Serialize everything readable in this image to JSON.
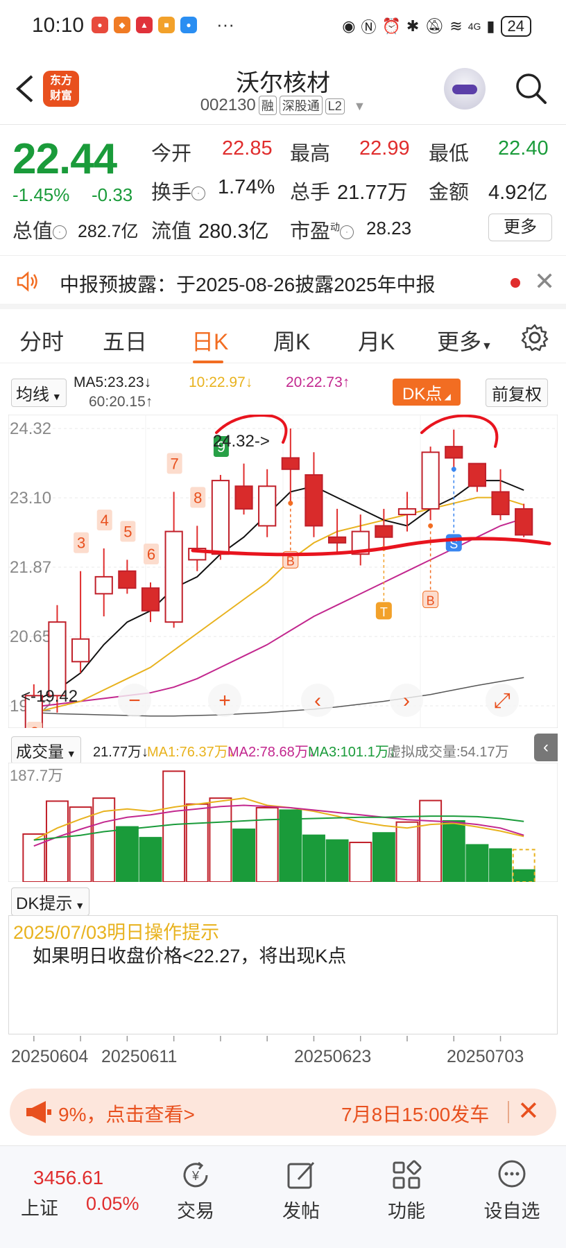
{
  "status": {
    "time": "10:10",
    "battery": "24",
    "network": "4G"
  },
  "header": {
    "back_icon": "chevron-left-icon",
    "logo_text_line1": "东方",
    "logo_text_line2": "财富",
    "title": "沃尔核材",
    "code": "002130",
    "tags": [
      "融",
      "深股通",
      "L2"
    ]
  },
  "quote": {
    "price": "22.44",
    "change_pct": "-1.45%",
    "change": "-0.33",
    "open_label": "今开",
    "open": "22.85",
    "high_label": "最高",
    "high": "22.99",
    "low_label": "最低",
    "low": "22.40",
    "turnover_label": "换手",
    "turnover": "1.74%",
    "volume_label": "总手",
    "volume": "21.77万",
    "amount_label": "金额",
    "amount": "4.92亿",
    "mktcap_label": "总值",
    "mktcap": "282.7亿",
    "float_label": "流值",
    "float": "280.3亿",
    "pe_label": "市盈",
    "pe_sup": "动",
    "pe": "28.23",
    "more_label": "更多"
  },
  "notice": {
    "text": "中报预披露：于2025-08-26披露2025年中报"
  },
  "tabs": [
    "分时",
    "五日",
    "日K",
    "周K",
    "月K",
    "更多"
  ],
  "active_tab": "日K",
  "ma": {
    "selector": "均线",
    "ma5": "MA5:23.23↓",
    "ma10": "10:22.97↓",
    "ma20": "20:22.73↑",
    "ma60": "60:20.15↑",
    "dk_label": "DK点",
    "adjust_label": "前复权"
  },
  "colors": {
    "up": "#e02d2d",
    "down": "#1a9b3a",
    "accent": "#f26d22",
    "ma5": "#111111",
    "ma10": "#e8b21e",
    "ma20": "#c2278e",
    "ma60": "#555555"
  },
  "chart_data": {
    "type": "candlestick",
    "y_labels": [
      "24.32",
      "23.10",
      "21.87",
      "20.65",
      "19.42"
    ],
    "ylim": [
      19.42,
      24.32
    ],
    "high_marker": "24.32->",
    "low_marker": "<-19.42",
    "candles": [
      {
        "o": 19.0,
        "h": 19.8,
        "l": 18.9,
        "c": 19.6
      },
      {
        "o": 19.6,
        "h": 21.2,
        "l": 19.3,
        "c": 20.9
      },
      {
        "o": 20.2,
        "h": 21.8,
        "l": 20.0,
        "c": 20.6
      },
      {
        "o": 21.4,
        "h": 22.2,
        "l": 21.0,
        "c": 21.7
      },
      {
        "o": 21.8,
        "h": 22.0,
        "l": 21.4,
        "c": 21.5
      },
      {
        "o": 21.5,
        "h": 21.6,
        "l": 20.9,
        "c": 21.1
      },
      {
        "o": 20.9,
        "h": 23.2,
        "l": 20.8,
        "c": 22.5
      },
      {
        "o": 22.0,
        "h": 22.6,
        "l": 21.8,
        "c": 22.2
      },
      {
        "o": 22.1,
        "h": 23.5,
        "l": 22.0,
        "c": 23.4
      },
      {
        "o": 23.3,
        "h": 23.7,
        "l": 22.8,
        "c": 22.9
      },
      {
        "o": 22.6,
        "h": 23.6,
        "l": 22.4,
        "c": 23.3
      },
      {
        "o": 23.8,
        "h": 24.32,
        "l": 23.0,
        "c": 23.6
      },
      {
        "o": 23.5,
        "h": 23.9,
        "l": 22.4,
        "c": 22.6
      },
      {
        "o": 22.4,
        "h": 22.9,
        "l": 22.1,
        "c": 22.3
      },
      {
        "o": 22.1,
        "h": 22.8,
        "l": 21.9,
        "c": 22.5
      },
      {
        "o": 22.6,
        "h": 22.9,
        "l": 22.2,
        "c": 22.4
      },
      {
        "o": 22.8,
        "h": 23.2,
        "l": 22.5,
        "c": 22.9
      },
      {
        "o": 22.9,
        "h": 24.0,
        "l": 22.7,
        "c": 23.9
      },
      {
        "o": 24.0,
        "h": 24.3,
        "l": 23.6,
        "c": 23.8
      },
      {
        "o": 23.7,
        "h": 23.7,
        "l": 23.2,
        "c": 23.3
      },
      {
        "o": 23.2,
        "h": 23.6,
        "l": 22.7,
        "c": 22.8
      },
      {
        "o": 22.9,
        "h": 22.99,
        "l": 22.4,
        "c": 22.44
      }
    ],
    "ma5": [
      19.5,
      19.7,
      20.0,
      20.5,
      20.9,
      21.1,
      21.5,
      21.7,
      22.1,
      22.4,
      22.8,
      23.2,
      23.3,
      23.1,
      22.9,
      22.7,
      22.6,
      22.9,
      23.1,
      23.4,
      23.4,
      23.23
    ],
    "ma10": [
      19.3,
      19.4,
      19.5,
      19.7,
      19.9,
      20.1,
      20.4,
      20.7,
      21.0,
      21.3,
      21.6,
      22.0,
      22.3,
      22.5,
      22.6,
      22.7,
      22.8,
      22.9,
      23.0,
      23.1,
      23.1,
      22.97
    ],
    "ma20": [
      19.4,
      19.45,
      19.5,
      19.55,
      19.6,
      19.65,
      19.75,
      19.9,
      20.1,
      20.3,
      20.5,
      20.75,
      21.0,
      21.2,
      21.4,
      21.6,
      21.8,
      22.0,
      22.2,
      22.4,
      22.6,
      22.73
    ],
    "ma60": [
      19.3,
      19.28,
      19.27,
      19.26,
      19.25,
      19.24,
      19.24,
      19.25,
      19.26,
      19.28,
      19.3,
      19.33,
      19.36,
      19.4,
      19.45,
      19.5,
      19.56,
      19.62,
      19.7,
      19.78,
      19.85,
      19.92
    ],
    "wave_numbers": [
      "2",
      "3",
      "4",
      "5",
      "6",
      "7",
      "8",
      "9"
    ],
    "signals": [
      "B",
      "B",
      "S",
      "T"
    ]
  },
  "volume": {
    "selector": "成交量",
    "vol": "21.77万↓",
    "ma1": "MA1:76.37万↓",
    "ma2": "MA2:78.68万↓",
    "ma3": "MA3:101.1万↓",
    "virtual": "虚拟成交量:54.17万",
    "max_label": "187.7万",
    "bars": [
      80,
      135,
      125,
      140,
      92,
      74,
      185,
      130,
      140,
      88,
      124,
      120,
      78,
      70,
      66,
      82,
      100,
      136,
      102,
      62,
      55,
      20
    ],
    "virtual_bar": 54
  },
  "dk": {
    "selector": "DK提示",
    "date_line": "2025/07/03明日操作提示",
    "text": "如果明日收盘价格<22.27，将出现K点"
  },
  "dates": [
    "20250604",
    "20250611",
    "20250623",
    "20250703"
  ],
  "banner": {
    "left_text": "9%，点击查看>",
    "right_text": "7月8日15:00发车"
  },
  "bottom": {
    "index_value": "3456.61",
    "index_name": "上证",
    "index_pct": "0.05%",
    "nav": [
      "交易",
      "发帖",
      "功能",
      "设自选"
    ]
  }
}
